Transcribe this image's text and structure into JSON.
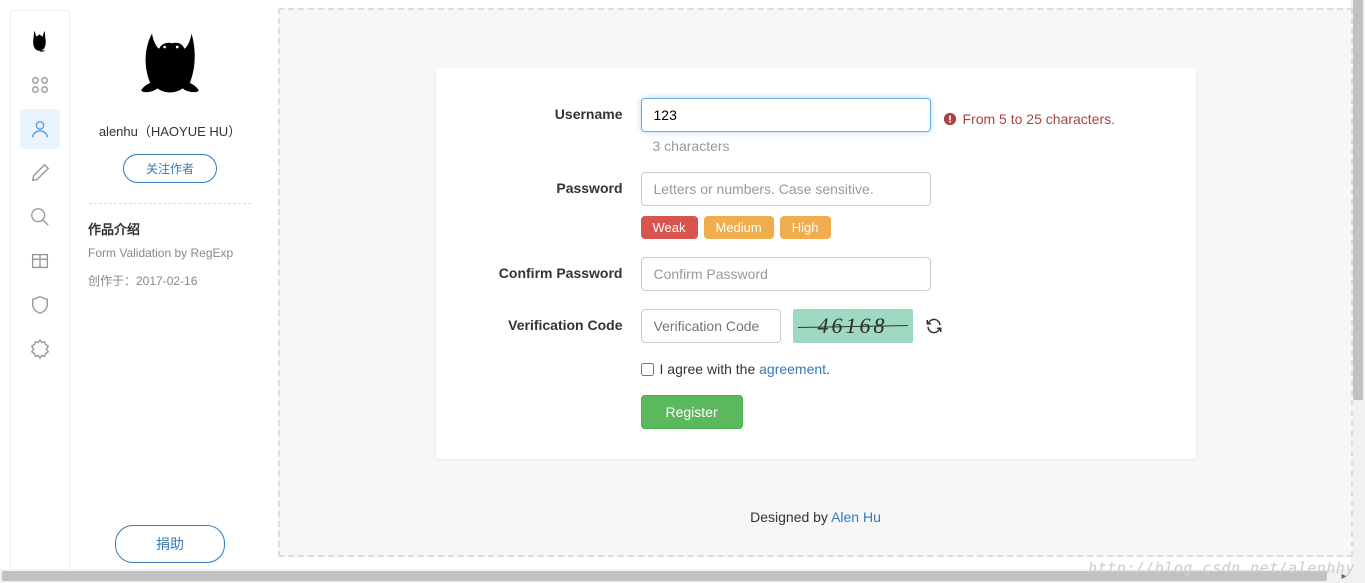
{
  "profile": {
    "name": "alenhu（HAOYUE HU）",
    "follow_btn": "关注作者",
    "intro_title": "作品介绍",
    "intro_sub": "Form Validation by RegExp",
    "intro_date": "创作于：2017-02-16",
    "donate_btn": "捐助"
  },
  "form": {
    "username": {
      "label": "Username",
      "value": "123",
      "hint": "3 characters",
      "error": "From 5 to 25 characters."
    },
    "password": {
      "label": "Password",
      "placeholder": "Letters or numbers. Case sensitive.",
      "strength": {
        "weak": "Weak",
        "medium": "Medium",
        "high": "High"
      }
    },
    "confirm": {
      "label": "Confirm Password",
      "placeholder": "Confirm Password"
    },
    "verification": {
      "label": "Verification Code",
      "placeholder": "Verification Code",
      "captcha_text": "46168"
    },
    "agree": {
      "prefix": "I agree with the ",
      "link": "agreement",
      "suffix": "."
    },
    "register_btn": "Register"
  },
  "footer": {
    "prefix": "Designed by ",
    "link": "Alen Hu"
  },
  "watermark": "http://blog.csdn.net/alenhhy"
}
